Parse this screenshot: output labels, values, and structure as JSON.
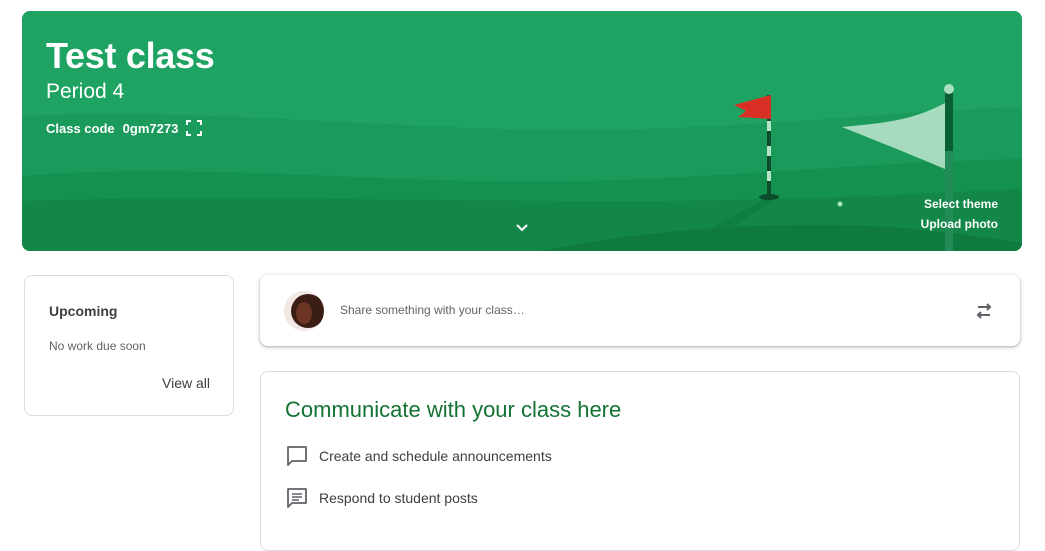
{
  "banner": {
    "title": "Test class",
    "section": "Period 4",
    "class_code_label": "Class code",
    "class_code": "0gm7273",
    "select_theme": "Select theme",
    "upload_photo": "Upload photo",
    "theme_color": "#1ea362"
  },
  "upcoming": {
    "title": "Upcoming",
    "empty_text": "No work due soon",
    "view_all": "View all"
  },
  "share": {
    "placeholder": "Share something with your class…"
  },
  "communicate": {
    "title": "Communicate with your class here",
    "features": [
      {
        "icon": "chat-bubble-icon",
        "label": "Create and schedule announcements"
      },
      {
        "icon": "comment-lines-icon",
        "label": "Respond to student posts"
      }
    ]
  },
  "colors": {
    "accent_green": "#137333",
    "banner_green": "#1ea362",
    "flag_red": "#d93025"
  }
}
